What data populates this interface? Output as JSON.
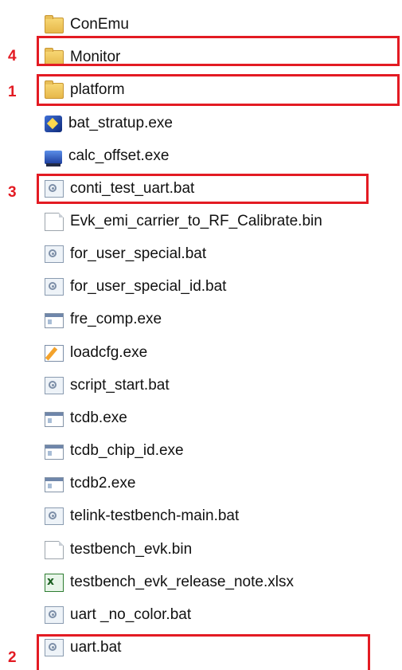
{
  "files": [
    {
      "name": "ConEmu",
      "icon": "folder-icon"
    },
    {
      "name": "Monitor",
      "icon": "folder-icon"
    },
    {
      "name": "platform",
      "icon": "folder-icon"
    },
    {
      "name": "bat_stratup.exe",
      "icon": "application-icon"
    },
    {
      "name": "calc_offset.exe",
      "icon": "computer-app-icon"
    },
    {
      "name": "conti_test_uart.bat",
      "icon": "batch-file-icon"
    },
    {
      "name": "Evk_emi_carrier_to_RF_Calibrate.bin",
      "icon": "blank-file-icon"
    },
    {
      "name": "for_user_special.bat",
      "icon": "batch-file-icon"
    },
    {
      "name": "for_user_special_id.bat",
      "icon": "batch-file-icon"
    },
    {
      "name": "fre_comp.exe",
      "icon": "executable-icon"
    },
    {
      "name": "loadcfg.exe",
      "icon": "config-edit-icon"
    },
    {
      "name": "script_start.bat",
      "icon": "batch-file-icon"
    },
    {
      "name": "tcdb.exe",
      "icon": "executable-icon"
    },
    {
      "name": "tcdb_chip_id.exe",
      "icon": "executable-icon"
    },
    {
      "name": "tcdb2.exe",
      "icon": "executable-icon"
    },
    {
      "name": "telink-testbench-main.bat",
      "icon": "batch-file-icon"
    },
    {
      "name": "testbench_evk.bin",
      "icon": "blank-file-icon"
    },
    {
      "name": "testbench_evk_release_note.xlsx",
      "icon": "excel-file-icon"
    },
    {
      "name": "uart _no_color.bat",
      "icon": "batch-file-icon"
    },
    {
      "name": "uart.bat",
      "icon": "batch-file-icon"
    }
  ],
  "annotations": [
    {
      "number": "4",
      "target": "Monitor"
    },
    {
      "number": "1",
      "target": "platform"
    },
    {
      "number": "3",
      "target": "conti_test_uart.bat"
    },
    {
      "number": "2",
      "target": "uart.bat"
    }
  ],
  "colors": {
    "highlight": "#e31b23",
    "text": "#111111",
    "background": "#ffffff"
  }
}
